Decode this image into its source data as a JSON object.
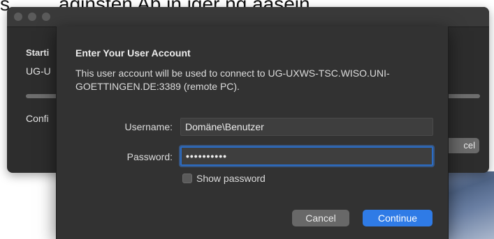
{
  "background_document": {
    "fragment_left": "s",
    "fragment_right": "aginsten Ab in iger ng aasein"
  },
  "background_window": {
    "starting_label": "Starti",
    "host_label": "UG-U",
    "config_label": "Confi",
    "cancel_label": "cel"
  },
  "dialog": {
    "title": "Enter Your User Account",
    "message": "This user account will be used to connect to UG-UXWS-TSC.WISO.UNI-GOETTINGEN.DE:3389 (remote PC).",
    "username_label": "Username:",
    "username_value": "Domäne\\Benutzer",
    "password_label": "Password:",
    "password_value": "••••••••••",
    "show_password_label": "Show password",
    "show_password_checked": false,
    "cancel_label": "Cancel",
    "continue_label": "Continue"
  },
  "colors": {
    "accent": "#2f7be6",
    "dialog_bg": "#323232",
    "window_bg": "#2d2d2d"
  }
}
